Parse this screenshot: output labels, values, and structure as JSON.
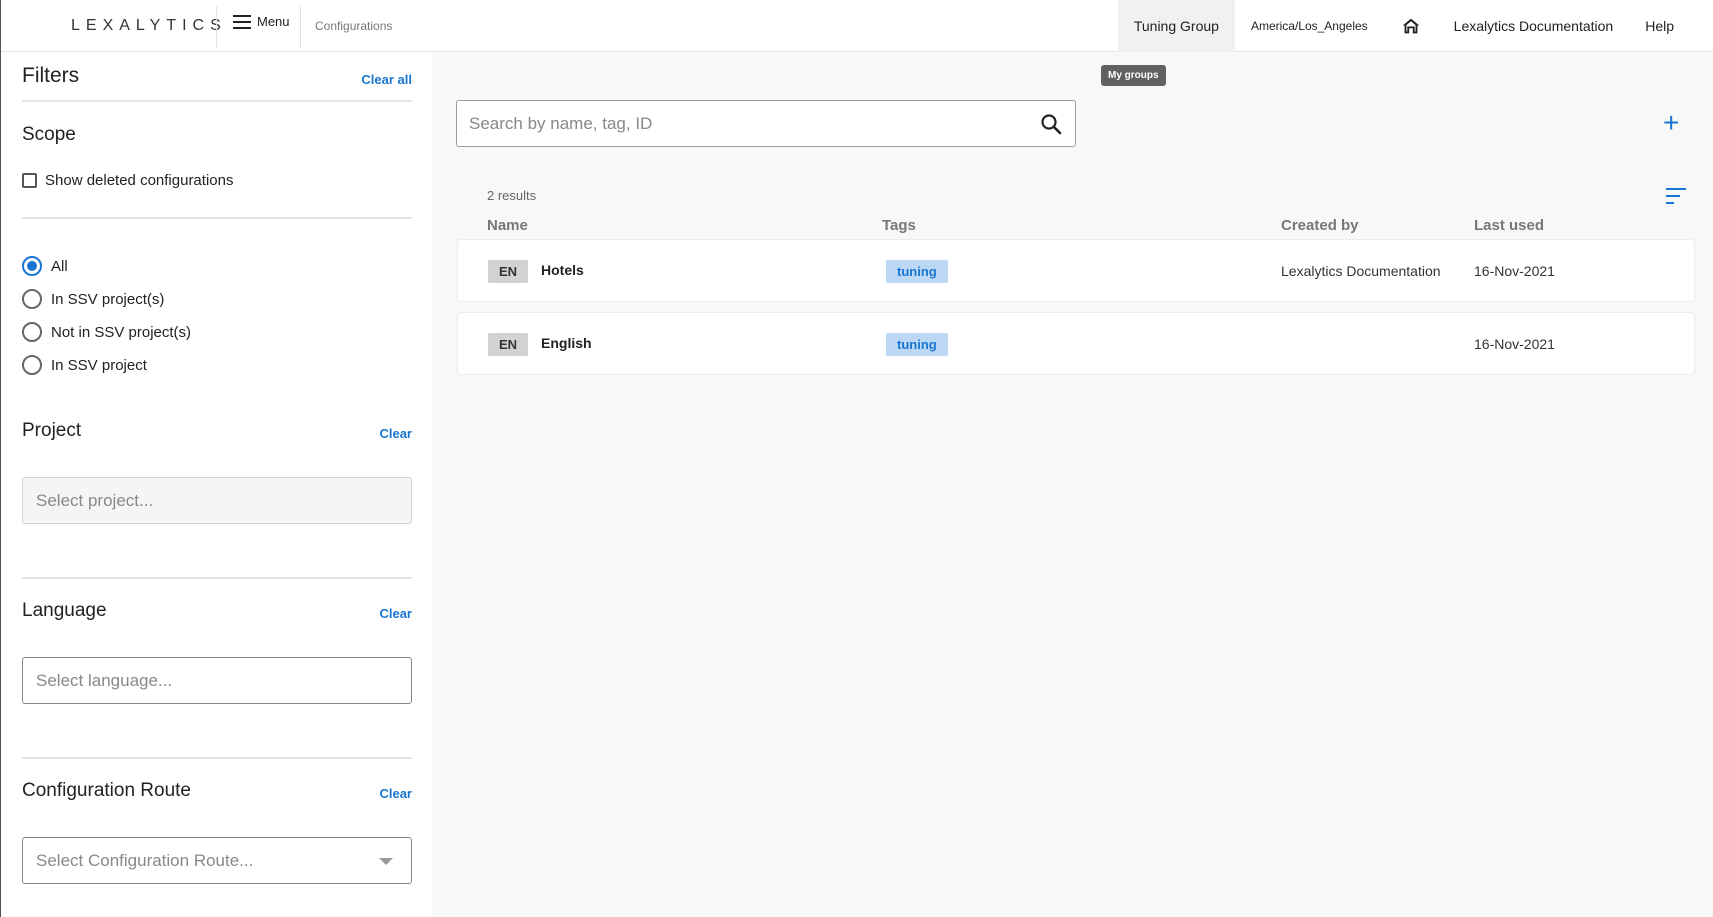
{
  "header": {
    "logo_text": "LEXALYTICS",
    "menu_label": "Menu",
    "breadcrumb": "Configurations",
    "nav": [
      "Tuning Group",
      "America/Los_Angeles",
      "Lexalytics Documentation",
      "Help"
    ],
    "home_icon": "home-icon",
    "tooltip": "My groups"
  },
  "sidebar": {
    "title": "Filters",
    "clear_all": "Clear all",
    "scope": {
      "title": "Scope",
      "checkbox_label": "Show deleted configurations",
      "options": [
        "All",
        "In SSV project(s)",
        "Not in SSV project(s)",
        "In SSV project"
      ],
      "selected": "All"
    },
    "project": {
      "title": "Project",
      "clear": "Clear",
      "placeholder": "Select project..."
    },
    "language": {
      "title": "Language",
      "clear": "Clear",
      "placeholder": "Select language..."
    },
    "route": {
      "title": "Configuration Route",
      "clear": "Clear",
      "placeholder": "Select Configuration Route..."
    }
  },
  "main": {
    "search_placeholder": "Search by name, tag, ID",
    "add_label": "+",
    "results_text": "2 results",
    "columns": [
      "Name",
      "Tags",
      "Created by",
      "Last used"
    ],
    "rows": [
      {
        "lang": "EN",
        "name": "Hotels",
        "tag": "tuning",
        "created_by": "Lexalytics Documentation",
        "last_used": "16-Nov-2021"
      },
      {
        "lang": "EN",
        "name": "English",
        "tag": "tuning",
        "created_by": "",
        "last_used": "16-Nov-2021"
      }
    ]
  },
  "colors": {
    "accent": "#1976d2",
    "tag_bg": "#bdd8f5",
    "lang_bg": "#d2d2d2"
  }
}
